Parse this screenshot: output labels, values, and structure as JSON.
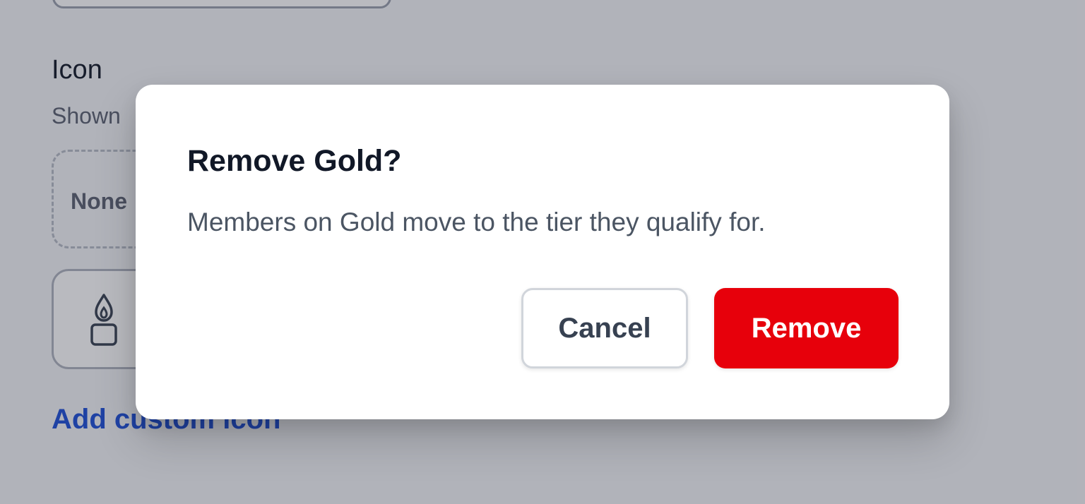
{
  "background": {
    "section_title": "Icon",
    "section_subtitle": "Shown",
    "none_option_label": "None",
    "custom_icon_name": "candle-icon",
    "add_custom_link": "Add custom icon"
  },
  "dialog": {
    "title": "Remove Gold?",
    "message": "Members on Gold move to the tier they qualify for.",
    "cancel_label": "Cancel",
    "remove_label": "Remove"
  },
  "colors": {
    "danger": "#e7000b",
    "link": "#1d4ed8",
    "title_text": "#111827",
    "body_text": "#4b5563"
  }
}
